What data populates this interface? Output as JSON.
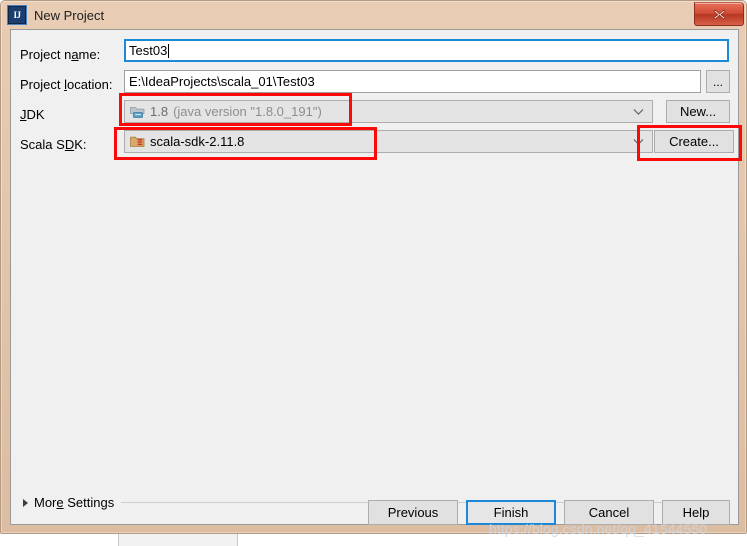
{
  "window": {
    "title": "New Project",
    "app_icon_label": "IJ",
    "close_icon": "close-x-icon"
  },
  "form": {
    "project_name": {
      "label_before": "Project n",
      "label_mnemonic": "a",
      "label_after": "me:",
      "label_full": "Project name:",
      "value": "Test03"
    },
    "project_location": {
      "label_before": "Project ",
      "label_mnemonic": "l",
      "label_after": "ocation:",
      "label_full": "Project location:",
      "value": "E:\\IdeaProjects\\scala_01\\Test03",
      "browse_button": "..."
    },
    "jdk": {
      "label_before": "",
      "label_mnemonic": "J",
      "label_after": "DK",
      "label_full": "JDK",
      "value_primary": "1.8",
      "value_secondary": "(java version \"1.8.0_191\")",
      "icon": "jdk-module-icon",
      "dropdown_icon": "chevron-down-icon",
      "action_button": "New..."
    },
    "scala_sdk": {
      "label_before": "Scala S",
      "label_mnemonic": "D",
      "label_after": "K:",
      "label_full": "Scala SDK:",
      "value": "scala-sdk-2.11.8",
      "icon": "scala-sdk-icon",
      "dropdown_icon": "chevron-down-icon",
      "action_button": "Create..."
    }
  },
  "more_settings": {
    "label_before": "Mor",
    "label_mnemonic": "e",
    "label_after": " Settings",
    "label_full": "More Settings",
    "expander_icon": "triangle-right-icon"
  },
  "footer": {
    "previous": "Previous",
    "finish": "Finish",
    "cancel": "Cancel",
    "help": "Help"
  },
  "watermark": {
    "text": "https://blog.csdn.net/qq_41544550"
  },
  "colors": {
    "annotation_red": "#fb0a0a",
    "focus_blue": "#1e88d8",
    "frame_beige": "#e3c6ac",
    "client_gray": "#f0f0f0"
  },
  "annotations": [
    {
      "name": "jdk-field-highlight"
    },
    {
      "name": "scala-sdk-field-highlight"
    },
    {
      "name": "create-button-highlight"
    }
  ]
}
